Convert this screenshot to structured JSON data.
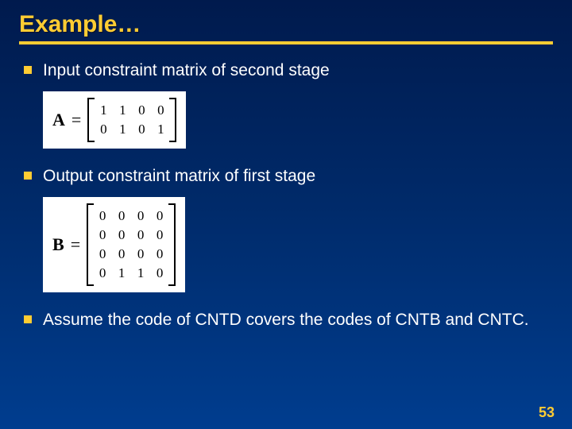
{
  "title": "Example…",
  "bullets": {
    "b1": "Input constraint matrix of second stage",
    "b2": "Output constraint matrix of first stage",
    "b3": "Assume the code of CNTD covers the codes of CNTB and CNTC."
  },
  "matrixA": {
    "label": "A",
    "eq": "=",
    "rows": [
      [
        "1",
        "1",
        "0",
        "0"
      ],
      [
        "0",
        "1",
        "0",
        "1"
      ]
    ]
  },
  "matrixB": {
    "label": "B",
    "eq": "=",
    "rows": [
      [
        "0",
        "0",
        "0",
        "0"
      ],
      [
        "0",
        "0",
        "0",
        "0"
      ],
      [
        "0",
        "0",
        "0",
        "0"
      ],
      [
        "0",
        "1",
        "1",
        "0"
      ]
    ]
  },
  "pageNumber": "53"
}
